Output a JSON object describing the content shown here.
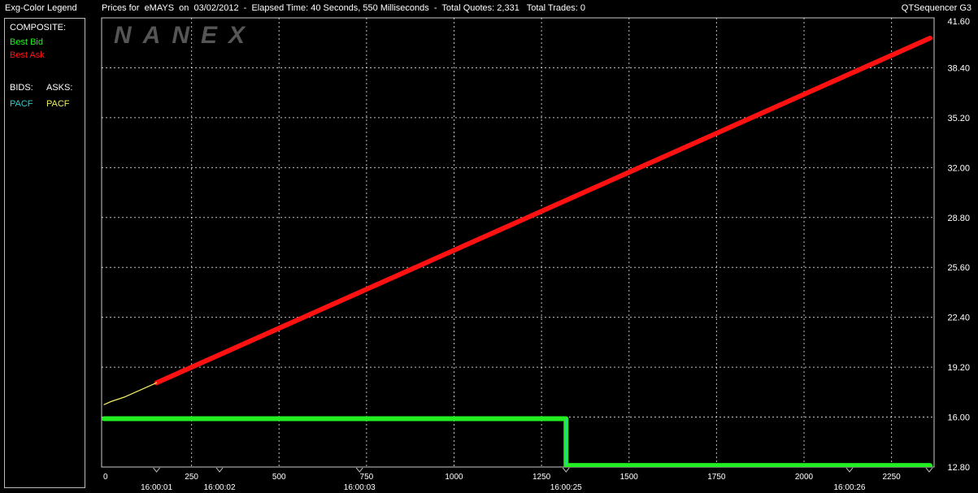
{
  "titlebar": {
    "legend_title": "Exg-Color Legend",
    "chart_title": "Prices for  eMAYS  on  03/02/2012  -  Elapsed Time: 40 Seconds, 550 Milliseconds  -  Total Quotes: 2,331   Total Trades: 0",
    "app_name": "QTSequencer G3"
  },
  "watermark": "NANEX",
  "legend": {
    "composite_label": "COMPOSITE:",
    "best_bid": "Best Bid",
    "best_ask": "Best Ask",
    "bids_label": "BIDS:",
    "asks_label": "ASKS:",
    "bid_exchange": "PACF",
    "ask_exchange": "PACF"
  },
  "colors": {
    "best_bid": "#22ee22",
    "best_ask": "#ff1111",
    "bid_exchange": "#33cccc",
    "ask_exchange": "#eeee66",
    "grid": "#ffffff",
    "background": "#000000"
  },
  "chart_data": {
    "type": "line",
    "xlim": [
      0,
      2360
    ],
    "ylim": [
      12.8,
      41.6
    ],
    "x_ticks": [
      0,
      250,
      500,
      750,
      1000,
      1250,
      1500,
      1750,
      2000,
      2250
    ],
    "y_ticks": [
      "12.80",
      "16.00",
      "19.20",
      "22.40",
      "25.60",
      "28.80",
      "32.00",
      "35.20",
      "38.40",
      "41.60"
    ],
    "time_labels": [
      {
        "x": 150,
        "label": "16:00:01"
      },
      {
        "x": 330,
        "label": "16:00:02"
      },
      {
        "x": 730,
        "label": "16:00:03"
      },
      {
        "x": 1320,
        "label": "16:00:25"
      },
      {
        "x": 2130,
        "label": "16:00:26"
      }
    ],
    "series": [
      {
        "name": "Best Ask",
        "x": [
          150,
          2360
        ],
        "y": [
          18.2,
          40.3
        ]
      },
      {
        "name": "PACF",
        "x": [
          0,
          20,
          60,
          150
        ],
        "y": [
          16.8,
          17.0,
          17.3,
          18.2
        ]
      },
      {
        "name": "Best Bid",
        "x": [
          0,
          1320,
          1320,
          2360
        ],
        "y": [
          15.9,
          15.9,
          12.9,
          12.9
        ]
      }
    ]
  }
}
